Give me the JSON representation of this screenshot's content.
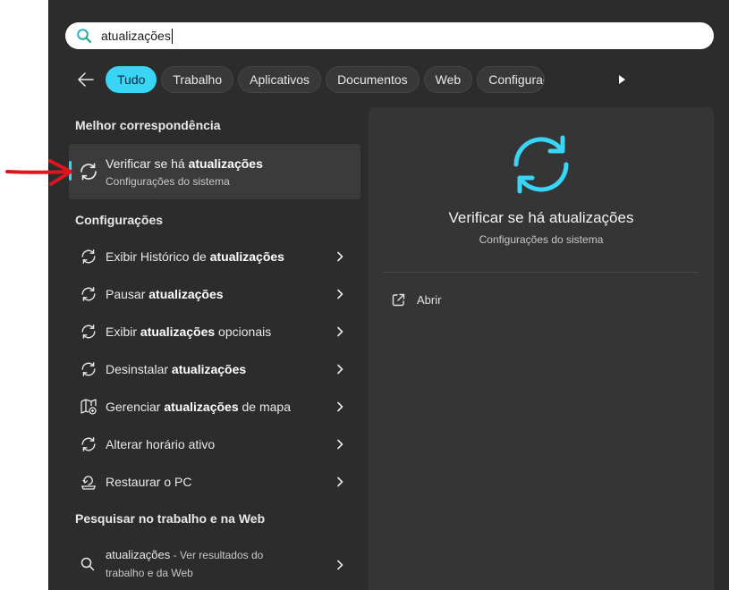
{
  "search": {
    "query": "atualizações"
  },
  "filters": {
    "items": [
      "Tudo",
      "Trabalho",
      "Aplicativos",
      "Documentos",
      "Web",
      "Configurações"
    ],
    "active": "Tudo"
  },
  "best_match": {
    "section_title": "Melhor correspondência",
    "title_prefix": "Verificar se há ",
    "title_bold": "atualizações",
    "subtitle": "Configurações do sistema"
  },
  "settings": {
    "section_title": "Configurações",
    "items": [
      {
        "before": "Exibir Histórico de ",
        "bold": "atualizações",
        "after": "",
        "icon": "sync-icon"
      },
      {
        "before": "Pausar ",
        "bold": "atualizações",
        "after": "",
        "icon": "sync-icon"
      },
      {
        "before": "Exibir ",
        "bold": "atualizações",
        "after": " opcionais",
        "icon": "sync-icon"
      },
      {
        "before": "Desinstalar ",
        "bold": "atualizações",
        "after": "",
        "icon": "sync-icon"
      },
      {
        "before": "Gerenciar ",
        "bold": "atualizações",
        "after": " de mapa",
        "icon": "map-icon"
      },
      {
        "before": "Alterar horário ativo",
        "bold": "",
        "after": "",
        "icon": "sync-icon"
      },
      {
        "before": "Restaurar o PC",
        "bold": "",
        "after": "",
        "icon": "restore-icon"
      }
    ]
  },
  "web": {
    "section_title": "Pesquisar no trabalho e na Web",
    "query": "atualizações",
    "suffix_line1": " - Ver resultados do",
    "suffix_line2": "trabalho e da Web"
  },
  "preview": {
    "title": "Verificar se há atualizações",
    "subtitle": "Configurações do sistema",
    "open_label": "Abrir"
  },
  "colors": {
    "accent": "#3ad5f4",
    "background": "#2c2c2c",
    "panel": "#353535",
    "arrow": "#e0141c"
  }
}
